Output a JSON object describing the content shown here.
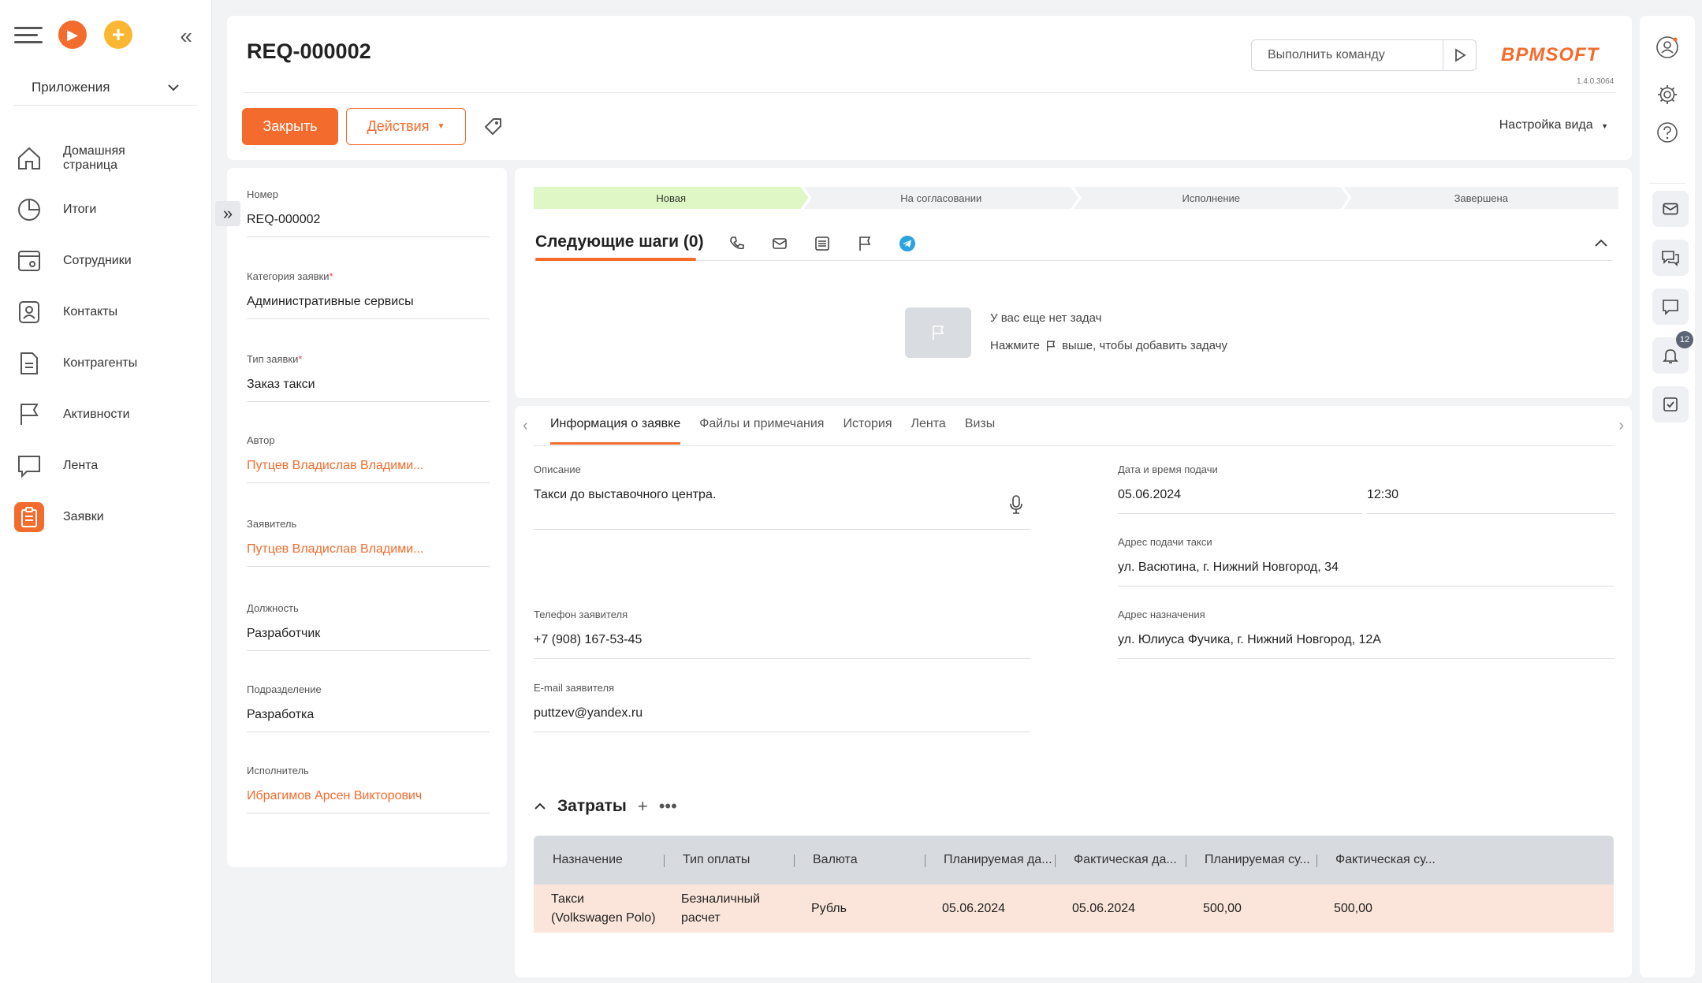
{
  "sidebar": {
    "apps_label": "Приложения",
    "items": [
      {
        "label": "Домашняя\nстраница"
      },
      {
        "label": "Итоги"
      },
      {
        "label": "Сотрудники"
      },
      {
        "label": "Контакты"
      },
      {
        "label": "Контрагенты"
      },
      {
        "label": "Активности"
      },
      {
        "label": "Лента"
      },
      {
        "label": "Заявки"
      }
    ]
  },
  "header": {
    "title": "REQ-000002",
    "command_placeholder": "Выполнить команду",
    "logo": "BPMSOFT",
    "version": "1.4.0.3064",
    "close_label": "Закрыть",
    "actions_label": "Действия",
    "view_settings_label": "Настройка вида"
  },
  "fields": {
    "number": {
      "label": "Номер",
      "value": "REQ-000002"
    },
    "category": {
      "label": "Категория заявки",
      "value": "Административные сервисы"
    },
    "type": {
      "label": "Тип заявки",
      "value": "Заказ такси"
    },
    "author": {
      "label": "Автор",
      "value": "Путцев Владислав Владими..."
    },
    "applicant": {
      "label": "Заявитель",
      "value": "Путцев Владислав Владими..."
    },
    "position": {
      "label": "Должность",
      "value": "Разработчик"
    },
    "department": {
      "label": "Подразделение",
      "value": "Разработка"
    },
    "executor": {
      "label": "Исполнитель",
      "value": "Ибрагимов Арсен Викторович"
    }
  },
  "stages": [
    "Новая",
    "На согласовании",
    "Исполнение",
    "Завершена"
  ],
  "next_steps": {
    "title": "Следующие шаги (0)",
    "empty_line1": "У вас еще нет задач",
    "empty_line2_prefix": "Нажмите",
    "empty_line2_suffix": "выше, чтобы добавить задачу"
  },
  "tabs": [
    "Информация о заявке",
    "Файлы и примечания",
    "История",
    "Лента",
    "Визы"
  ],
  "details": {
    "description": {
      "label": "Описание",
      "value": "Такси до выставочного центра."
    },
    "phone": {
      "label": "Телефон заявителя",
      "value": "+7 (908) 167-53-45"
    },
    "email": {
      "label": "E-mail заявителя",
      "value": "puttzev@yandex.ru"
    },
    "datetime": {
      "label": "Дата и время подачи",
      "date": "05.06.2024",
      "time": "12:30"
    },
    "pickup": {
      "label": "Адрес подачи такси",
      "value": "ул. Васютина, г. Нижний Новгород, 34"
    },
    "destination": {
      "label": "Адрес назначения",
      "value": "ул. Юлиуса Фучика, г. Нижний Новгород, 12А"
    }
  },
  "expenses": {
    "title": "Затраты",
    "columns": [
      "Назначение",
      "Тип оплаты",
      "Валюта",
      "Планируемая да...",
      "Фактическая да...",
      "Планируемая су...",
      "Фактическая су..."
    ],
    "rows": [
      [
        "Такси\n(Volkswagen Polo)",
        "Безналичный\nрасчет",
        "Рубль",
        "05.06.2024",
        "05.06.2024",
        "500,00",
        "500,00"
      ]
    ]
  },
  "rail": {
    "notifications_count": "12"
  },
  "colors": {
    "accent": "#f36b2d",
    "stage_active": "#dff7c4",
    "row_highlight": "#fbe5da"
  }
}
